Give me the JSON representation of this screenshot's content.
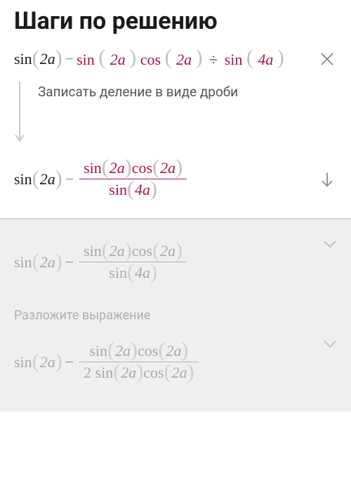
{
  "title": "Шаги по решению",
  "step1": {
    "hint": "Записать деление в виде дроби",
    "sin": "sin",
    "cos": "cos",
    "arg2a": "2a",
    "arg4a": "4a",
    "minus": "−",
    "plus_minus": "−",
    "div": "÷"
  },
  "faded": {
    "hint": "Разложите выражение",
    "sin": "sin",
    "cos": "cos",
    "arg2a": "2a",
    "arg4a": "4a",
    "denom_prefix": "2 sin"
  }
}
